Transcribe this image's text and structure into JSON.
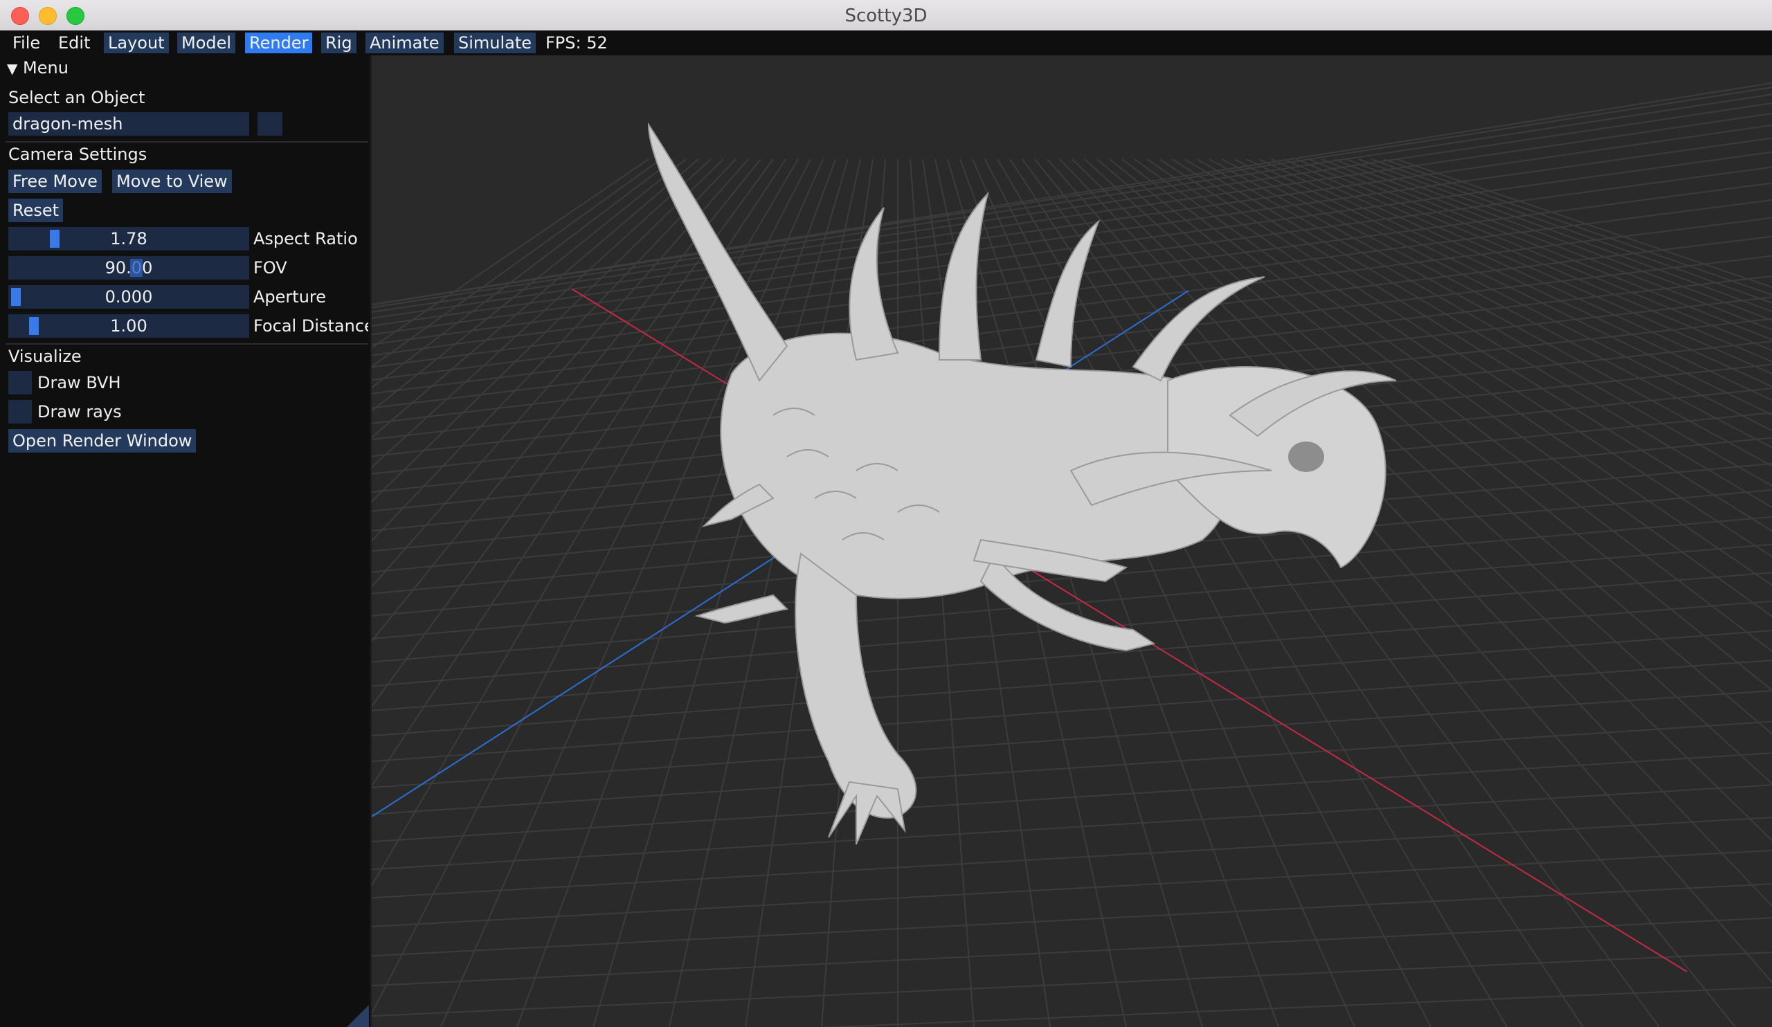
{
  "window": {
    "title": "Scotty3D"
  },
  "menubar": {
    "file": "File",
    "edit": "Edit",
    "layout": "Layout",
    "model": "Model",
    "render": "Render",
    "rig": "Rig",
    "animate": "Animate",
    "simulate": "Simulate",
    "fps": "FPS: 52"
  },
  "panel": {
    "menu_header": "Menu",
    "select_object_label": "Select an Object",
    "selected_object": "dragon-mesh",
    "camera_settings_label": "Camera Settings",
    "free_move": "Free Move",
    "move_to_view": "Move to View",
    "reset": "Reset",
    "sliders": [
      {
        "label": "Aspect Ratio",
        "value": "1.78"
      },
      {
        "label": "FOV",
        "value": "90.00"
      },
      {
        "label": "Aperture",
        "value": "0.000"
      },
      {
        "label": "Focal Distance",
        "value": "1.00"
      }
    ],
    "visualize_label": "Visualize",
    "draw_bvh": "Draw BVH",
    "draw_bvh_checked": false,
    "draw_rays": "Draw rays",
    "draw_rays_checked": false,
    "open_render_window": "Open Render Window"
  },
  "viewport": {
    "axis_x_color": "#c42a44",
    "axis_z_color": "#2a6fd6",
    "grid_color": "#3c3c3c",
    "background": "#2a2a2a",
    "model_color": "#cfcfcf"
  }
}
